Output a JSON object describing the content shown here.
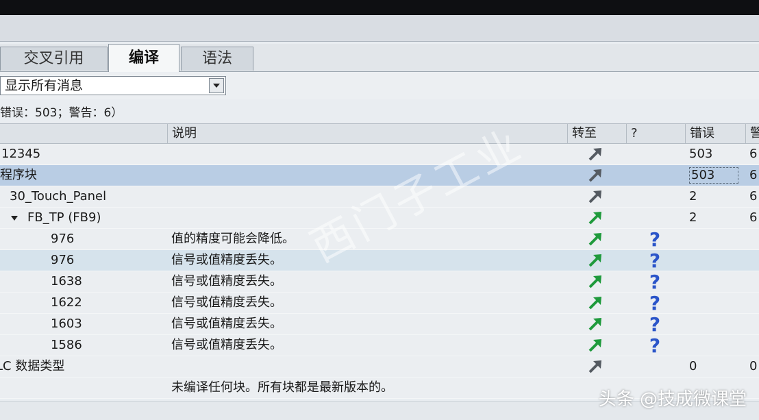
{
  "tabs": [
    {
      "label": "交叉引用"
    },
    {
      "label": "编译"
    },
    {
      "label": "语法"
    }
  ],
  "filter": {
    "value": "显示所有消息"
  },
  "summary": "错误：503；警告：6）",
  "columns": {
    "name": "",
    "desc": "说明",
    "goto": "转至",
    "help": "?",
    "errors": "错误",
    "warnings": "警"
  },
  "rows": [
    {
      "name": "12345",
      "desc": "",
      "errors": "503",
      "warnings": "6"
    },
    {
      "name": "程序块",
      "desc": "",
      "errors": "503",
      "warnings": "6"
    },
    {
      "name": "30_Touch_Panel",
      "desc": "",
      "errors": "2",
      "warnings": "6"
    },
    {
      "name": "FB_TP (FB9)",
      "desc": "",
      "errors": "2",
      "warnings": "6"
    },
    {
      "name": "976",
      "desc": "值的精度可能会降低。",
      "help": "?",
      "errors": "",
      "warnings": ""
    },
    {
      "name": "976",
      "desc": "信号或值精度丢失。",
      "help": "?",
      "errors": "",
      "warnings": ""
    },
    {
      "name": "1638",
      "desc": "信号或值精度丢失。",
      "help": "?",
      "errors": "",
      "warnings": ""
    },
    {
      "name": "1622",
      "desc": "信号或值精度丢失。",
      "help": "?",
      "errors": "",
      "warnings": ""
    },
    {
      "name": "1603",
      "desc": "信号或值精度丢失。",
      "help": "?",
      "errors": "",
      "warnings": ""
    },
    {
      "name": "1586",
      "desc": "信号或值精度丢失。",
      "help": "?",
      "errors": "",
      "warnings": ""
    },
    {
      "name": "LC 数据类型",
      "desc": "",
      "errors": "0",
      "warnings": "0"
    },
    {
      "name": "",
      "desc": "未编译任何块。所有块都是最新版本的。",
      "errors": "",
      "warnings": ""
    }
  ],
  "watermark": "西门子工业",
  "brand": "头条 @技成微课堂",
  "colors": {
    "arrow_gray": "#555b62",
    "arrow_green": "#1f9a3c",
    "help_blue": "#2b55c9",
    "selected_row": "#b9cde4"
  }
}
